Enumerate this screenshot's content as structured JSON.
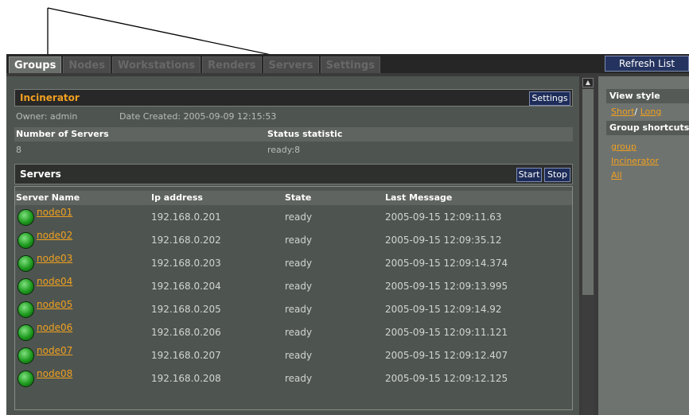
{
  "tabs": [
    {
      "label": "Groups",
      "active": true
    },
    {
      "label": "Nodes",
      "active": false
    },
    {
      "label": "Workstations",
      "active": false
    },
    {
      "label": "Renders",
      "active": false
    },
    {
      "label": "Servers",
      "active": false
    },
    {
      "label": "Settings",
      "active": false
    }
  ],
  "refresh_label": "Refresh List",
  "group": {
    "title": "Incinerator",
    "settings_label": "Settings",
    "owner": "Owner: admin",
    "date_created": "Date Created: 2005-09-09 12:15:53",
    "num_servers_label": "Number of Servers",
    "num_servers_value": "8",
    "status_label": "Status statistic",
    "status_value": "ready:8"
  },
  "servers": {
    "title": "Servers",
    "start_label": "Start",
    "stop_label": "Stop",
    "columns": [
      "Server Name",
      "Ip address",
      "State",
      "Last Message"
    ],
    "rows": [
      {
        "name": "node01",
        "ip": "192.168.0.201",
        "state": "ready",
        "last": "2005-09-15 12:09:11.63"
      },
      {
        "name": "node02",
        "ip": "192.168.0.202",
        "state": "ready",
        "last": "2005-09-15 12:09:35.12"
      },
      {
        "name": "node03",
        "ip": "192.168.0.203",
        "state": "ready",
        "last": "2005-09-15 12:09:14.374"
      },
      {
        "name": "node04",
        "ip": "192.168.0.204",
        "state": "ready",
        "last": "2005-09-15 12:09:13.995"
      },
      {
        "name": "node05",
        "ip": "192.168.0.205",
        "state": "ready",
        "last": "2005-09-15 12:09:14.92"
      },
      {
        "name": "node06",
        "ip": "192.168.0.206",
        "state": "ready",
        "last": "2005-09-15 12:09:11.121"
      },
      {
        "name": "node07",
        "ip": "192.168.0.207",
        "state": "ready",
        "last": "2005-09-15 12:09:12.407"
      },
      {
        "name": "node08",
        "ip": "192.168.0.208",
        "state": "ready",
        "last": "2005-09-15 12:09:12.125"
      }
    ]
  },
  "sidebar": {
    "view_style_label": "View style",
    "short_label": "Short",
    "separator": "/",
    "long_label": "Long",
    "shortcuts_label": "Group shortcuts",
    "links": [
      "group",
      "Incinerator",
      "All"
    ]
  },
  "colors": {
    "accent_link": "#f0a020",
    "status_ready": "#2fb32f",
    "button_blue": "#1d2c58"
  },
  "icons": {
    "status": "green-status-dot-icon",
    "scroll_up": "scroll-up-arrow-icon"
  }
}
